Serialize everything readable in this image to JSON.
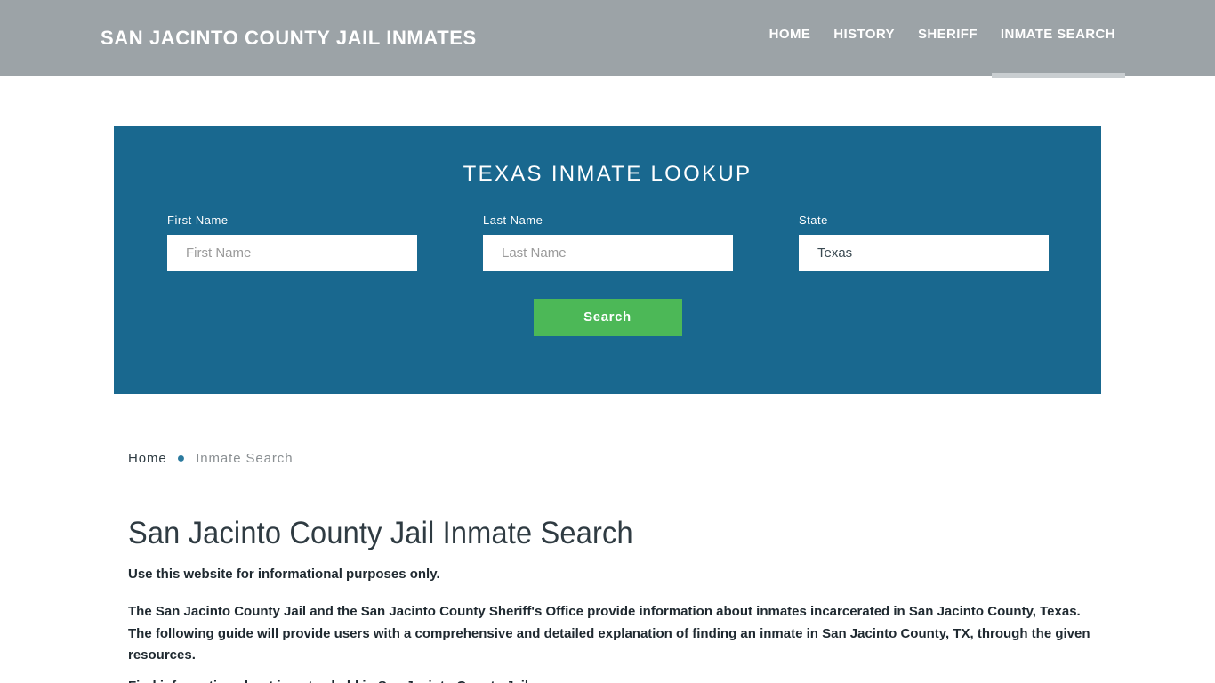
{
  "header": {
    "site_title": "SAN JACINTO COUNTY JAIL INMATES",
    "nav": [
      {
        "label": "HOME",
        "active": false
      },
      {
        "label": "HISTORY",
        "active": false
      },
      {
        "label": "SHERIFF",
        "active": false
      },
      {
        "label": "INMATE SEARCH",
        "active": true
      }
    ]
  },
  "lookup": {
    "title": "TEXAS INMATE LOOKUP",
    "fields": {
      "first_name": {
        "label": "First Name",
        "placeholder": "First Name",
        "value": ""
      },
      "last_name": {
        "label": "Last Name",
        "placeholder": "Last Name",
        "value": ""
      },
      "state": {
        "label": "State",
        "placeholder": "State",
        "value": "Texas",
        "options": [
          "Texas"
        ]
      }
    },
    "search_button": "Search"
  },
  "breadcrumb": {
    "home": "Home",
    "separator": "●",
    "current": "Inmate Search"
  },
  "content": {
    "page_title": "San Jacinto County Jail Inmate Search",
    "lead": "Use this website for informational purposes only.",
    "paragraph": "The San Jacinto County Jail and the San Jacinto County Sheriff's Office provide information about inmates incarcerated in San Jacinto County, Texas. The following guide will provide users with a comprehensive and detailed explanation of finding an inmate in San Jacinto County, TX, through the given resources.",
    "clipped_line": "Find information about inmates held in San Jacinto County Jail"
  },
  "colors": {
    "header_bg": "#9ca3a7",
    "panel_bg": "#19688f",
    "button_green": "#4cb857",
    "text_dark": "#1f2930",
    "breadcrumb_accent": "#2b7a9e"
  }
}
